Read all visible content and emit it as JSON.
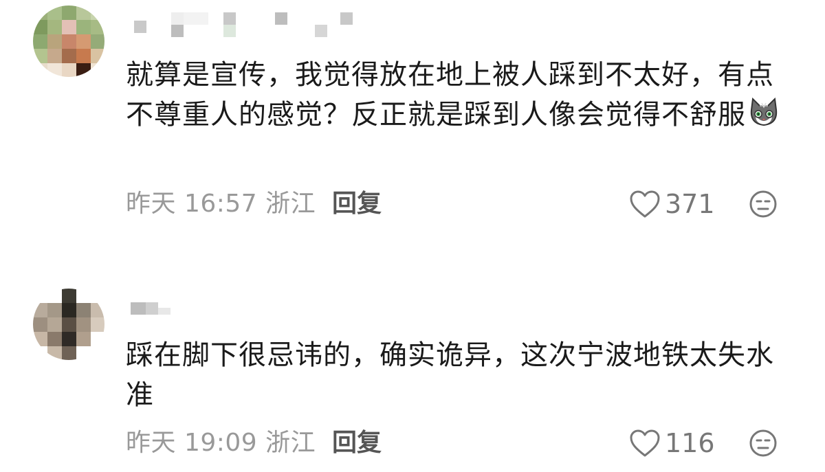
{
  "comments": [
    {
      "text": "就算是宣传，我觉得放在地上被人踩到不太好，有点不尊重人的感觉？反正就是踩到人像会觉得不舒服",
      "time": "昨天 16:57",
      "location": "浙江",
      "reply_label": "回复",
      "likes": "371",
      "has_cat_emoji": true
    },
    {
      "text": "踩在脚下很忌讳的，确实诡异，这次宁波地铁太失水准",
      "time": "昨天 19:09",
      "location": "浙江",
      "reply_label": "回复",
      "likes": "116",
      "has_cat_emoji": false
    }
  ],
  "icons": {
    "like": "heart-outline-icon",
    "dislike": "unamused-face-icon",
    "emoji": "gray-cat-emoji"
  },
  "colors": {
    "meta": "#999999",
    "reply": "#555555",
    "text": "#1a1a1a"
  }
}
